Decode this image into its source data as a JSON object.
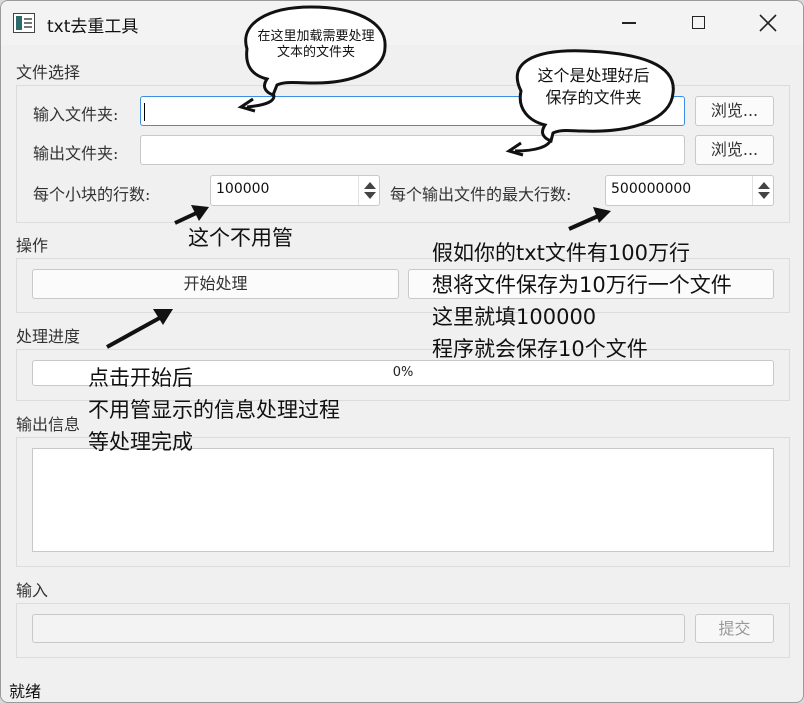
{
  "window": {
    "title": "txt去重工具"
  },
  "file_section": {
    "label": "文件选择",
    "input_folder_label": "输入文件夹:",
    "input_folder_value": "",
    "output_folder_label": "输出文件夹:",
    "output_folder_value": "",
    "browse_label": "浏览...",
    "lines_per_chunk_label": "每个小块的行数:",
    "lines_per_chunk_value": "100000",
    "max_lines_label": "每个输出文件的最大行数:",
    "max_lines_value": "500000000"
  },
  "operation_section": {
    "label": "操作",
    "start_button": "开始处理",
    "second_button": ""
  },
  "progress_section": {
    "label": "处理进度",
    "percent": "0%",
    "value": 0
  },
  "output_section": {
    "label": "输出信息",
    "text": ""
  },
  "input_section": {
    "label": "输入",
    "value": "",
    "submit_label": "提交"
  },
  "status_bar": {
    "text": "就绪"
  },
  "annotations": {
    "bubble_input": [
      "在这里加载需要处理",
      "文本的文件夹"
    ],
    "bubble_output": [
      "这个是处理好后",
      "保存的文件夹"
    ],
    "ignore_chunk": "这个不用管",
    "explain_lines": [
      "假如你的txt文件有100万行",
      "想将文件保存为10万行一个文件",
      "这里就填100000",
      "程序就会保存10个文件"
    ],
    "start_hint": [
      "点击开始后",
      "不用管显示的信息处理过程",
      "等处理完成"
    ]
  }
}
